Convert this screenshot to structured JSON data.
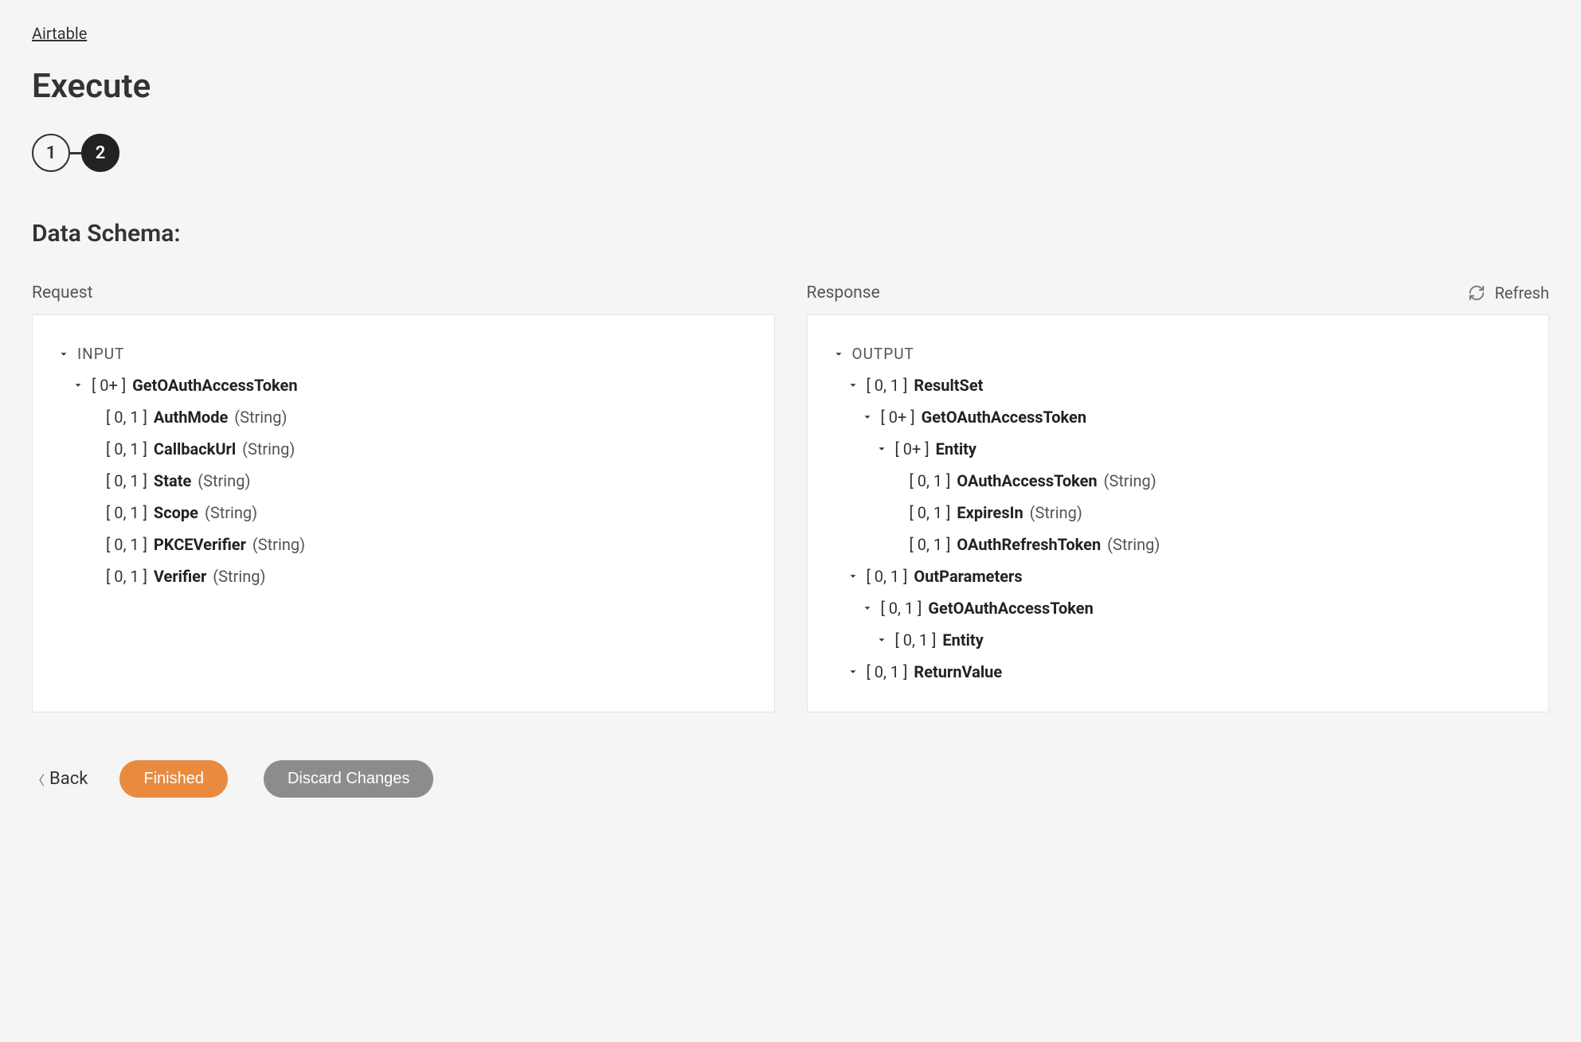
{
  "breadcrumb": "Airtable",
  "page_title": "Execute",
  "stepper": {
    "step1": "1",
    "step2": "2"
  },
  "section_title": "Data Schema:",
  "columns": {
    "request": "Request",
    "response": "Response",
    "refresh": "Refresh"
  },
  "request_tree": {
    "root": "INPUT",
    "l1": {
      "card": "[ 0+ ]",
      "name": "GetOAuthAccessToken"
    },
    "leaves": [
      {
        "card": "[ 0, 1 ]",
        "name": "AuthMode",
        "type": "(String)"
      },
      {
        "card": "[ 0, 1 ]",
        "name": "CallbackUrl",
        "type": "(String)"
      },
      {
        "card": "[ 0, 1 ]",
        "name": "State",
        "type": "(String)"
      },
      {
        "card": "[ 0, 1 ]",
        "name": "Scope",
        "type": "(String)"
      },
      {
        "card": "[ 0, 1 ]",
        "name": "PKCEVerifier",
        "type": "(String)"
      },
      {
        "card": "[ 0, 1 ]",
        "name": "Verifier",
        "type": "(String)"
      }
    ]
  },
  "response_tree": {
    "root": "OUTPUT",
    "rs": {
      "card": "[ 0, 1 ]",
      "name": "ResultSet"
    },
    "rs_g": {
      "card": "[ 0+ ]",
      "name": "GetOAuthAccessToken"
    },
    "rs_e": {
      "card": "[ 0+ ]",
      "name": "Entity"
    },
    "rs_leaves": [
      {
        "card": "[ 0, 1 ]",
        "name": "OAuthAccessToken",
        "type": "(String)"
      },
      {
        "card": "[ 0, 1 ]",
        "name": "ExpiresIn",
        "type": "(String)"
      },
      {
        "card": "[ 0, 1 ]",
        "name": "OAuthRefreshToken",
        "type": "(String)"
      }
    ],
    "op": {
      "card": "[ 0, 1 ]",
      "name": "OutParameters"
    },
    "op_g": {
      "card": "[ 0, 1 ]",
      "name": "GetOAuthAccessToken"
    },
    "op_e": {
      "card": "[ 0, 1 ]",
      "name": "Entity"
    },
    "rv": {
      "card": "[ 0, 1 ]",
      "name": "ReturnValue"
    }
  },
  "footer": {
    "back": "Back",
    "finished": "Finished",
    "discard": "Discard Changes"
  }
}
